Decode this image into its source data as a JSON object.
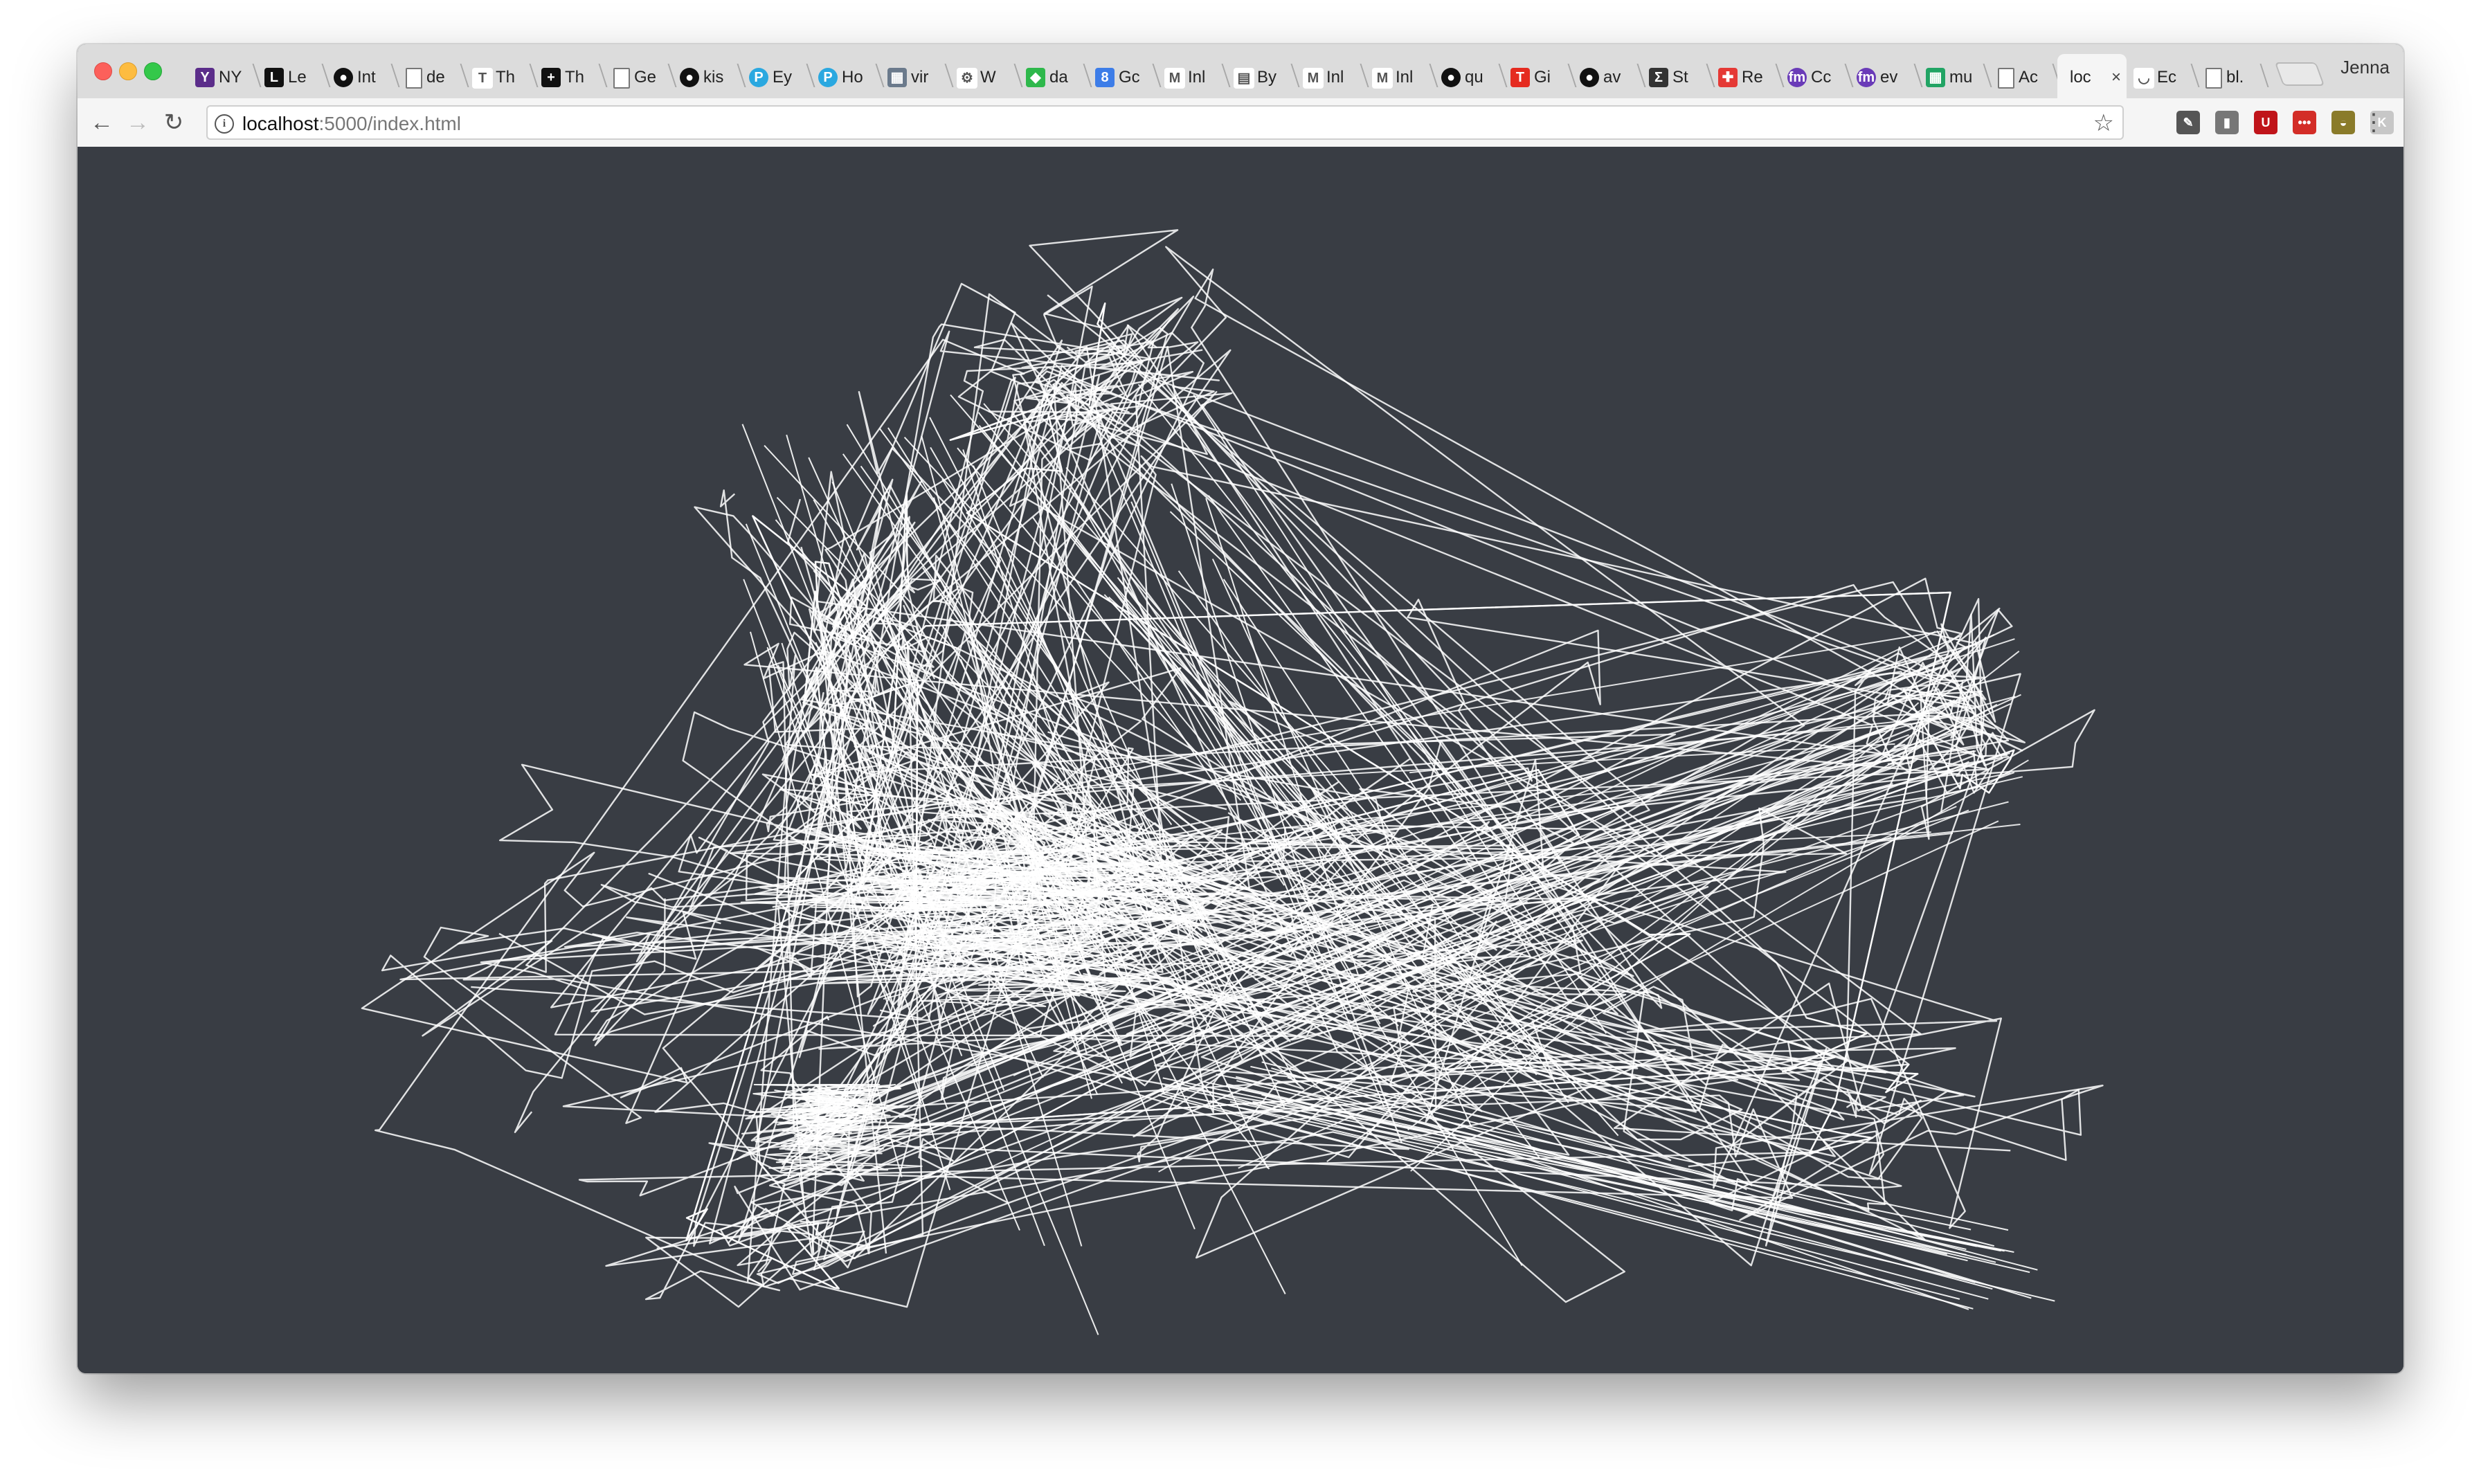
{
  "browser": {
    "tabs": [
      {
        "label": "NY",
        "icon": "ny-app-icon",
        "color": "#5b2d8a",
        "glyph": "Y"
      },
      {
        "label": "Le",
        "icon": "le-icon",
        "color": "#111111",
        "glyph": "L"
      },
      {
        "label": "Int",
        "icon": "github-icon",
        "color": "#111111",
        "glyph": "●"
      },
      {
        "label": "de",
        "icon": "document-icon",
        "color": "#ffffff",
        "glyph": ""
      },
      {
        "label": "Th",
        "icon": "nytimes-icon",
        "color": "#ffffff",
        "glyph": "T"
      },
      {
        "label": "Th",
        "icon": "the-icon",
        "color": "#111111",
        "glyph": "+"
      },
      {
        "label": "Ge",
        "icon": "document-icon",
        "color": "#ffffff",
        "glyph": ""
      },
      {
        "label": "kis",
        "icon": "github-icon",
        "color": "#111111",
        "glyph": "●"
      },
      {
        "label": "Ey",
        "icon": "p-circle-icon",
        "color": "#2aa8e0",
        "glyph": "P"
      },
      {
        "label": "Ho",
        "icon": "p-circle-icon",
        "color": "#2aa8e0",
        "glyph": "P"
      },
      {
        "label": "vir",
        "icon": "table-icon",
        "color": "#6b7a8c",
        "glyph": "▦"
      },
      {
        "label": "W",
        "icon": "wheel-icon",
        "color": "#ffffff",
        "glyph": "⚙"
      },
      {
        "label": "da",
        "icon": "green-diamond-icon",
        "color": "#2eb84b",
        "glyph": "◆"
      },
      {
        "label": "Gc",
        "icon": "calendar-icon",
        "color": "#3d7de8",
        "glyph": "8"
      },
      {
        "label": "Inl",
        "icon": "gmail-icon",
        "color": "#ffffff",
        "glyph": "M"
      },
      {
        "label": "By",
        "icon": "news-icon",
        "color": "#ffffff",
        "glyph": "▤"
      },
      {
        "label": "Inl",
        "icon": "gmail-icon",
        "color": "#ffffff",
        "glyph": "M"
      },
      {
        "label": "Inl",
        "icon": "gmail-icon",
        "color": "#ffffff",
        "glyph": "M"
      },
      {
        "label": "qu",
        "icon": "github-icon",
        "color": "#111111",
        "glyph": "●"
      },
      {
        "label": "Gi",
        "icon": "t-red-icon",
        "color": "#e52b20",
        "glyph": "T"
      },
      {
        "label": "av",
        "icon": "github-icon",
        "color": "#111111",
        "glyph": "●"
      },
      {
        "label": "St",
        "icon": "stackexchange-icon",
        "color": "#333333",
        "glyph": "Σ"
      },
      {
        "label": "Re",
        "icon": "red-cross-icon",
        "color": "#e53935",
        "glyph": "✚"
      },
      {
        "label": "Cc",
        "icon": "fm-circle-icon",
        "color": "#6a3bb8",
        "glyph": "fm"
      },
      {
        "label": "ev",
        "icon": "fm-circle-icon",
        "color": "#6a3bb8",
        "glyph": "fm"
      },
      {
        "label": "mu",
        "icon": "sheets-icon",
        "color": "#21a464",
        "glyph": "▦"
      },
      {
        "label": "Ac",
        "icon": "document-icon",
        "color": "#ffffff",
        "glyph": ""
      },
      {
        "label": "loc",
        "icon": "localhost-icon",
        "color": "#f5f5f5",
        "glyph": "",
        "active": true
      },
      {
        "label": "Ec",
        "icon": "loading-icon",
        "color": "#ffffff",
        "glyph": "◡"
      },
      {
        "label": "bl.",
        "icon": "document-icon",
        "color": "#ffffff",
        "glyph": ""
      }
    ],
    "active_tab_close": "×",
    "profile_name": "Jenna",
    "url_host": "localhost",
    "url_rest": ":5000/index.html",
    "back_icon": "←",
    "forward_icon": "→",
    "reload_icon": "↻",
    "info_icon": "i",
    "bookmark_icon": "☆",
    "menu_icon": "⋮",
    "extensions": [
      {
        "name": "evernote-icon",
        "color": "#555555",
        "glyph": "✎"
      },
      {
        "name": "bookmark-ext-icon",
        "color": "#777777",
        "glyph": "▮"
      },
      {
        "name": "ublock-icon",
        "color": "#c0141a",
        "glyph": "U"
      },
      {
        "name": "lastpass-icon",
        "color": "#d32d27",
        "glyph": "•••"
      },
      {
        "name": "pot-icon",
        "color": "#8a7b2a",
        "glyph": "◒"
      },
      {
        "name": "generic-ext-icon",
        "color": "#c7c7c7",
        "glyph": "K"
      }
    ]
  },
  "page": {
    "background": "#393d44",
    "line_color": "#ffffff"
  }
}
